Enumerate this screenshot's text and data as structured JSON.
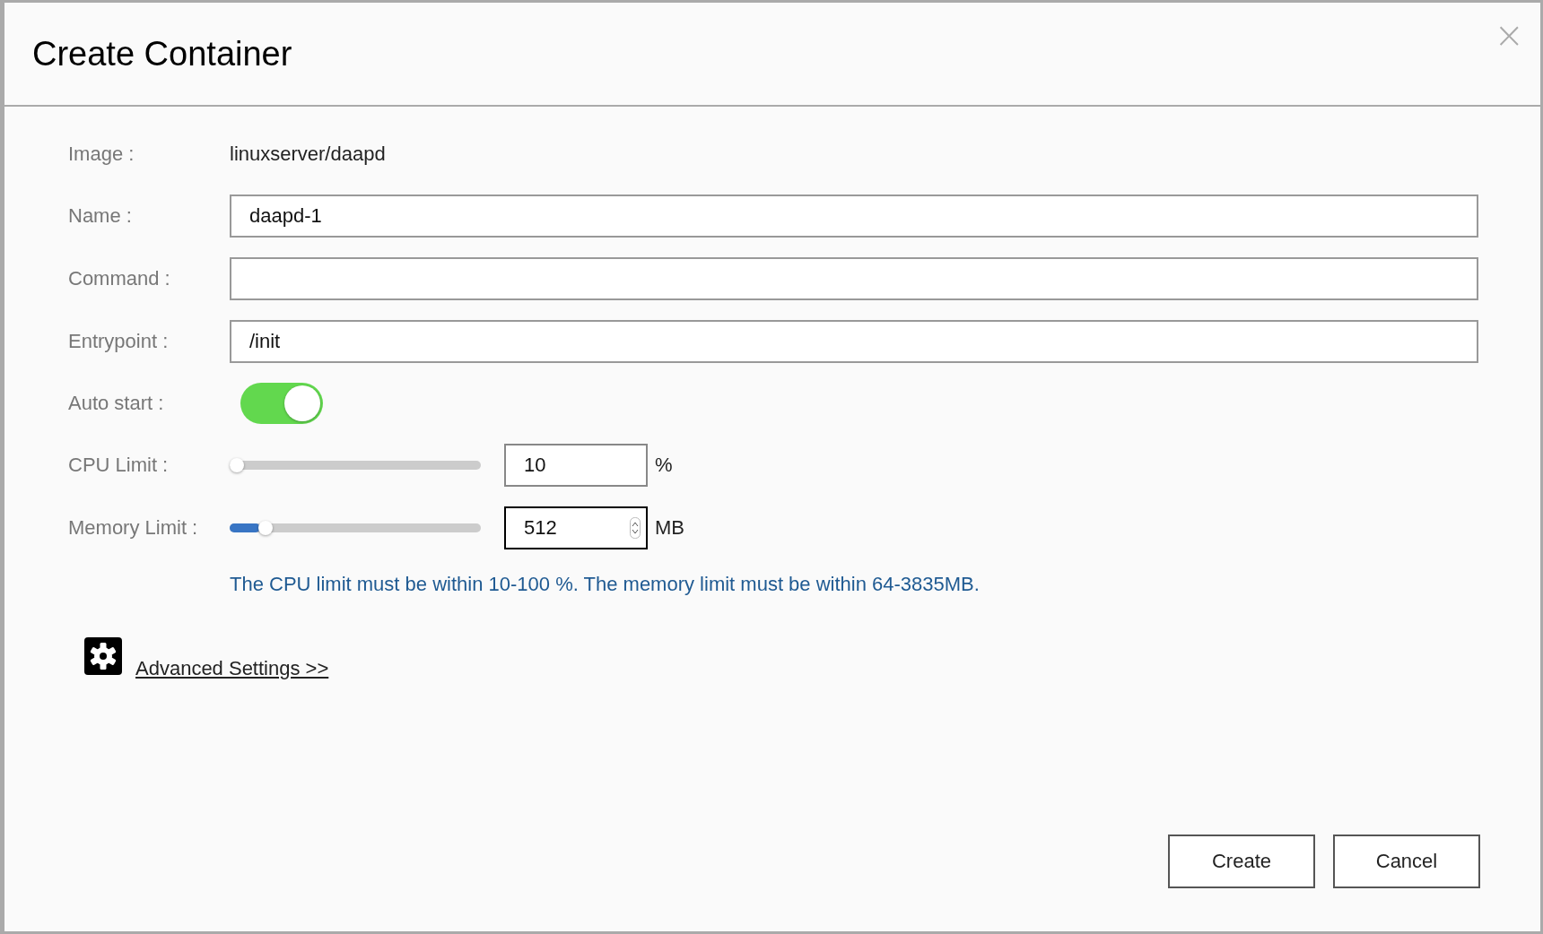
{
  "dialog": {
    "title": "Create Container",
    "close": "×"
  },
  "form": {
    "image": {
      "label": "Image :",
      "value": "linuxserver/daapd"
    },
    "name": {
      "label": "Name :",
      "value": "daapd-1"
    },
    "command": {
      "label": "Command :"
    },
    "entrypoint": {
      "label": "Entrypoint :",
      "value": "/init"
    },
    "auto_start": {
      "label": "Auto start :",
      "on": true
    },
    "cpu_limit": {
      "label": "CPU Limit :",
      "level": 0,
      "value": "10",
      "unit": "%",
      "focused": false
    },
    "memory_limit": {
      "label": "Memory Limit :",
      "level": 0.12,
      "value": "512",
      "unit": "MB",
      "focused": true
    },
    "note": "The CPU limit must be within 10-100 %. The memory limit must be within 64-3835MB."
  },
  "advanced_link": "Advanced Settings >>",
  "buttons": [
    {
      "label": "Create"
    },
    {
      "label": "Cancel"
    }
  ]
}
